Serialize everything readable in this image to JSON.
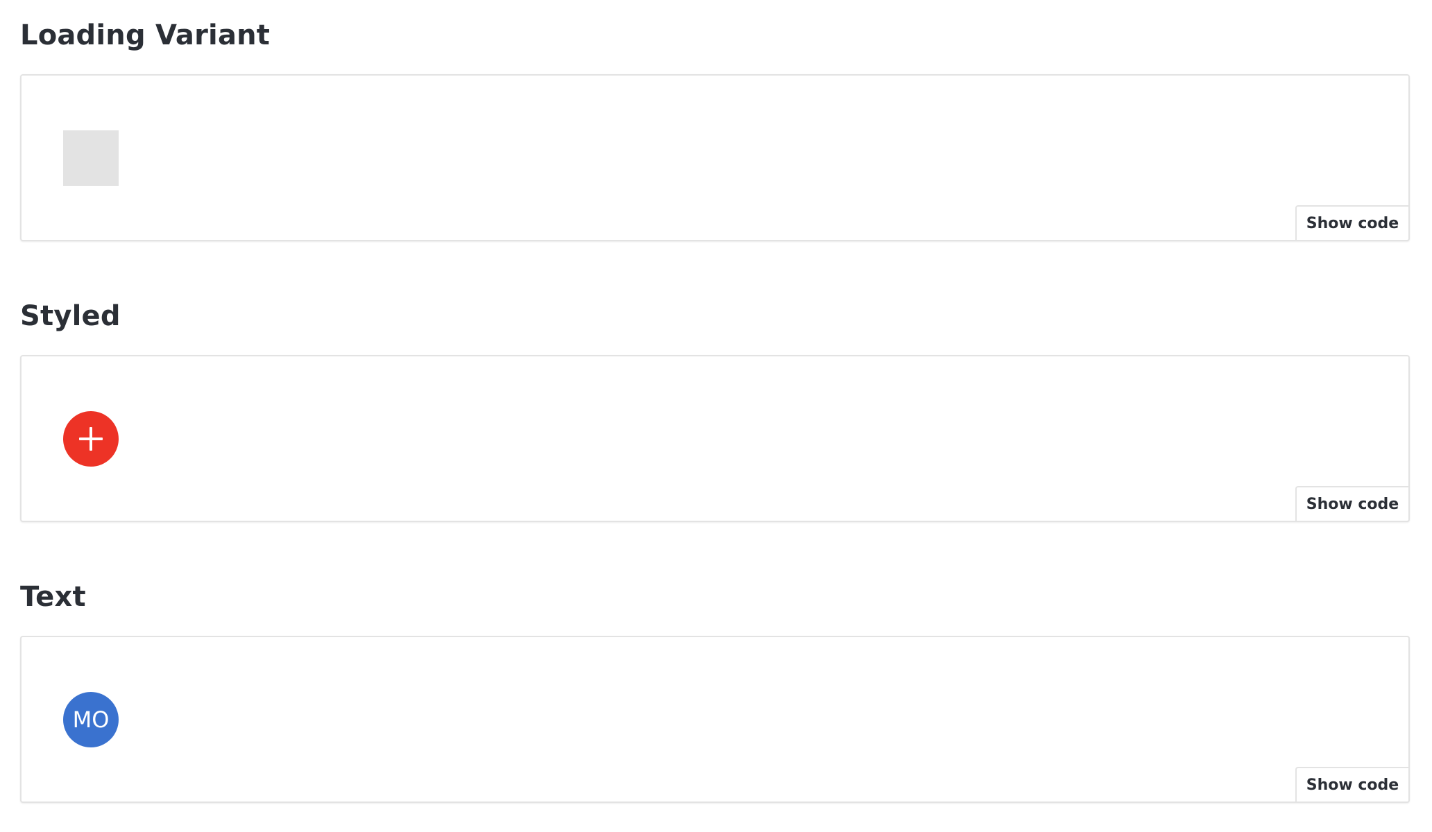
{
  "sections": [
    {
      "title": "Loading Variant",
      "avatar_variant": "loading",
      "avatar_color": "#e3e3e3",
      "show_code_label": "Show code"
    },
    {
      "title": "Styled",
      "avatar_variant": "icon",
      "avatar_icon": "plus-icon",
      "avatar_color": "#ed3326",
      "show_code_label": "Show code"
    },
    {
      "title": "Text",
      "avatar_variant": "text",
      "avatar_text": "MO",
      "avatar_color": "#3a72cf",
      "show_code_label": "Show code"
    }
  ]
}
